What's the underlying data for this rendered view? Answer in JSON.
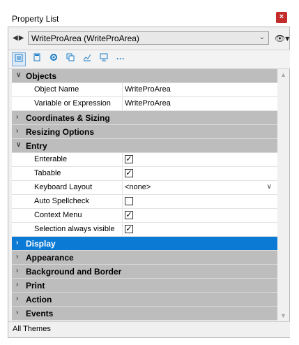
{
  "window": {
    "title": "Property List",
    "close_glyph": "×"
  },
  "object_selector": {
    "back_forward_glyph": "◀▶",
    "value": "WriteProArea (WriteProArea)",
    "eye_glyph": "👁▾"
  },
  "toolbar": {
    "icons": [
      "list-icon",
      "calculator-icon",
      "gear-icon",
      "copy-icon",
      "chart-icon",
      "monitor-icon",
      "more-icon"
    ]
  },
  "sections": [
    {
      "label": "Objects",
      "expanded": true,
      "arrow": "∨",
      "props": [
        {
          "name": "Object Name",
          "type": "text",
          "value": "WriteProArea"
        },
        {
          "name": "Variable or Expression",
          "type": "text",
          "value": "WriteProArea"
        }
      ]
    },
    {
      "label": "Coordinates & Sizing",
      "expanded": false,
      "arrow": "›"
    },
    {
      "label": "Resizing Options",
      "expanded": false,
      "arrow": "›"
    },
    {
      "label": "Entry",
      "expanded": true,
      "arrow": "∨",
      "props": [
        {
          "name": "Enterable",
          "type": "checkbox",
          "checked": true
        },
        {
          "name": "Tabable",
          "type": "checkbox",
          "checked": true
        },
        {
          "name": "Keyboard Layout",
          "type": "dropdown",
          "value": "<none>"
        },
        {
          "name": "Auto Spellcheck",
          "type": "checkbox",
          "checked": false
        },
        {
          "name": "Context Menu",
          "type": "checkbox",
          "checked": true
        },
        {
          "name": "Selection always visible",
          "type": "checkbox",
          "checked": true
        }
      ]
    },
    {
      "label": "Display",
      "expanded": false,
      "selected": true,
      "arrow": "›"
    },
    {
      "label": "Appearance",
      "expanded": false,
      "arrow": "›"
    },
    {
      "label": "Background and Border",
      "expanded": false,
      "arrow": "›"
    },
    {
      "label": "Print",
      "expanded": false,
      "arrow": "›"
    },
    {
      "label": "Action",
      "expanded": false,
      "arrow": "›"
    },
    {
      "label": "Events",
      "expanded": false,
      "arrow": "›"
    }
  ],
  "footer": {
    "text": "All Themes"
  },
  "colors": {
    "selected": "#0b7ad4",
    "section_bg": "#bdbdbd",
    "close_bg": "#c42b2b",
    "icon": "#1a7ec9"
  }
}
